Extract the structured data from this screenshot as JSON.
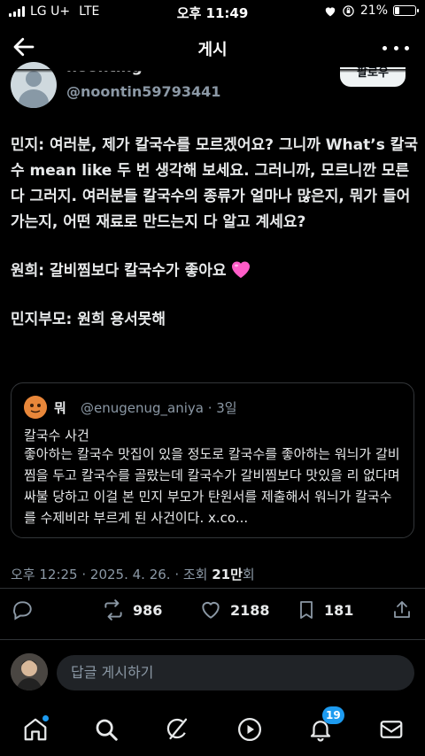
{
  "status_bar": {
    "carrier": "LG U+",
    "network": "LTE",
    "time": "오후 11:49",
    "battery": "21%",
    "battery_level": 0.21
  },
  "header": {
    "title": "게시",
    "back_icon": "back-arrow-icon",
    "more_icon": "more-icon"
  },
  "author": {
    "display_name": "noonting",
    "handle": "@noontin59793441",
    "follow_label": "팔로우"
  },
  "post": {
    "paragraphs": [
      "민지: 여러분, 제가 칼국수를 모르겠어요? 그니까 What’s 칼국수 mean like 두 번 생각해 보세요. 그러니까, 모르니깐 모른다 그러지. 여러분들 칼국수의 종류가 얼마나 많은지, 뭐가 들어가는지, 어떤 재료로 만드는지 다 알고 계세요?",
      "원희: 갈비찜보다 칼국수가 좋아요",
      "민지부모: 원희 용서못해"
    ]
  },
  "quote": {
    "name": "뭐",
    "handle_time": "@enugenug_aniya · 3일",
    "title": "칼국수 사건",
    "body": "좋아하는 칼국수 맛집이 있을 정도로 칼국수를 좋아하는 워늬가 갈비찜을 두고 칼국수를 골랐는데 칼국수가 갈비찜보다 맛있을 리 없다며 싸불 당하고 이걸 본 민지 부모가 탄원서를 제출해서 워늬가 칼국수를 수제비라 부르게 된 사건이다. x.co..."
  },
  "meta": {
    "timestamp": "오후 12:25 · 2025. 4. 26. · 조회 ",
    "views": "21만",
    "views_suffix": "회"
  },
  "actions": {
    "retweets": "986",
    "likes": "2188",
    "bookmarks": "181"
  },
  "reply": {
    "placeholder": "답글 게시하기"
  },
  "tabbar": {
    "notifications_badge": "19"
  },
  "colors": {
    "accent": "#1d9bf0",
    "heart": "#ff5cc8"
  }
}
